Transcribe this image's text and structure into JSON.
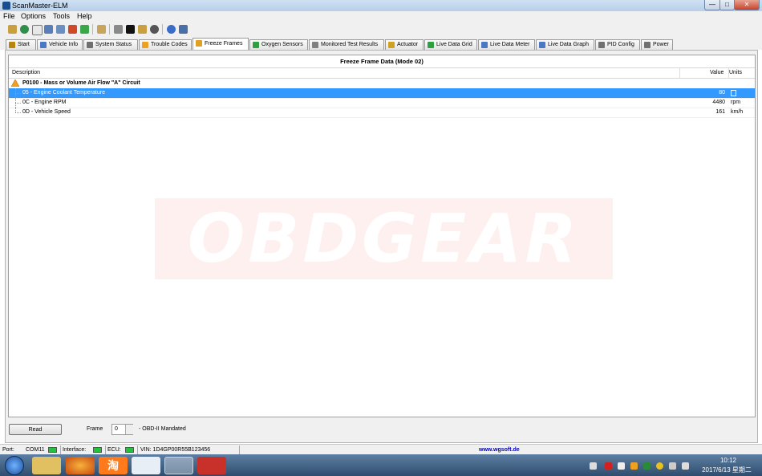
{
  "window": {
    "title": "ScanMaster-ELM",
    "minimize": "—",
    "maximize": "□",
    "close": "✕"
  },
  "menu": [
    "File",
    "Options",
    "Tools",
    "Help"
  ],
  "toolbar": {
    "icons": [
      "wand-icon",
      "globe-icon",
      "page-icon",
      "grid-icon",
      "chart-icon",
      "list-icon",
      "flower-icon",
      "clipboard-icon",
      "chip-icon",
      "monitor-icon",
      "plug-icon",
      "disk-icon",
      "info-icon",
      "book-icon"
    ]
  },
  "tabs": [
    {
      "label": "Start",
      "icon": "hand-icon",
      "color": "#b8860b"
    },
    {
      "label": "Vehicle Info",
      "icon": "info-icon",
      "color": "#4a78c2"
    },
    {
      "label": "System Status",
      "icon": "grid-icon",
      "color": "#707070"
    },
    {
      "label": "Trouble Codes",
      "icon": "warning-icon",
      "color": "#f0a020"
    },
    {
      "label": "Freeze Frames",
      "icon": "snowflake-icon",
      "color": "#e0a020"
    },
    {
      "label": "Oxygen Sensors",
      "icon": "sensor-icon",
      "color": "#2fa040"
    },
    {
      "label": "Monitored Test Results",
      "icon": "gear-icon",
      "color": "#808080"
    },
    {
      "label": "Actuator",
      "icon": "actuator-icon",
      "color": "#d0a020"
    },
    {
      "label": "Live Data Grid",
      "icon": "grid-icon",
      "color": "#2fa040"
    },
    {
      "label": "Live Data Meter",
      "icon": "meter-icon",
      "color": "#4a78c2"
    },
    {
      "label": "Live Data Graph",
      "icon": "graph-icon",
      "color": "#4a78c2"
    },
    {
      "label": "PID Config",
      "icon": "config-icon",
      "color": "#707070"
    },
    {
      "label": "Power",
      "icon": "power-icon",
      "color": "#707070"
    }
  ],
  "grid": {
    "title": "Freeze Frame Data (Mode 02)",
    "col_description": "Description",
    "col_value": "Value",
    "col_units": "Units",
    "dtc": "P0100 - Mass or Volume Air Flow \"A\" Circuit",
    "rows": [
      {
        "description": "05 - Engine Coolant Temperature",
        "value": "80",
        "unit": "",
        "unit_icon": "thermometer-icon",
        "selected": true
      },
      {
        "description": "0C - Engine RPM",
        "value": "4480",
        "unit": "rpm",
        "selected": false
      },
      {
        "description": "0D - Vehicle Speed",
        "value": "161",
        "unit": "km/h",
        "selected": false
      }
    ]
  },
  "watermark": "OBDGEAR",
  "controls": {
    "read": "Read",
    "frame_label": "Frame",
    "frame_value": "0",
    "frame_note": "- OBD-II Mandated"
  },
  "status": {
    "port_label": "Port:",
    "port_value": "COM11",
    "interface_label": "Interface:",
    "ecu_label": "ECU:",
    "vin": "VIN: 1D4GP00R55B123456",
    "website": "www.wgsoft.de",
    "led_color": "#22c33a"
  },
  "taskbar": {
    "apps": [
      "explorer-icon",
      "firefox-icon",
      "taobao-icon",
      "app-icon",
      "usb-icon",
      "toolbox-icon"
    ],
    "taobao_glyph": "淘",
    "time": "10:12",
    "date": "2017/6/13 星期二"
  }
}
